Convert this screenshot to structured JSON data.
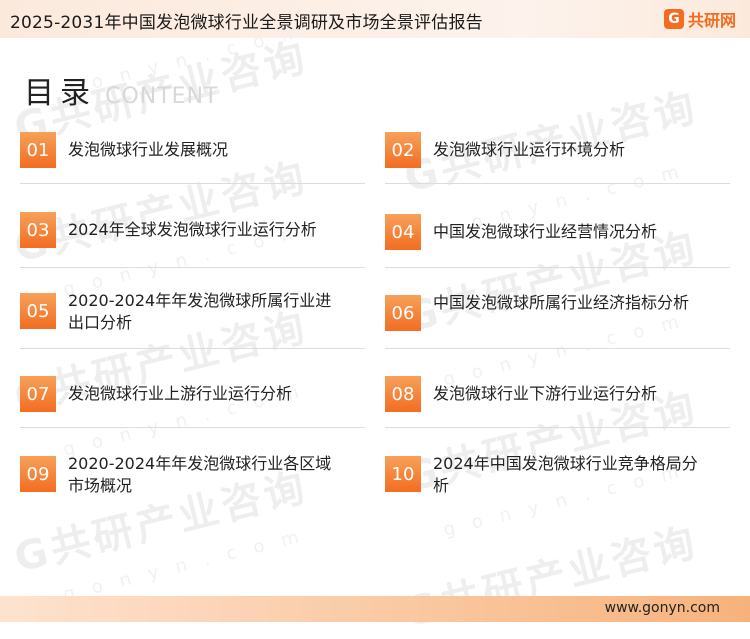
{
  "header": {
    "title": "2025-2031年中国发泡微球行业全景调研及市场全景评估报告"
  },
  "logo": {
    "mark": "G",
    "name": "共研网"
  },
  "watermark": {
    "text": "G共研产业咨询",
    "domain": "g o n y n . c o m"
  },
  "toc": {
    "title": "目录",
    "subtitle": "CONTENT",
    "items": [
      {
        "num": "01",
        "label": "发泡微球行业发展概况"
      },
      {
        "num": "02",
        "label": "发泡微球行业运行环境分析"
      },
      {
        "num": "03",
        "label": "2024年全球发泡微球行业运行分析"
      },
      {
        "num": "04",
        "label": "中国发泡微球行业经营情况分析"
      },
      {
        "num": "05",
        "label": "2020-2024年年发泡微球所属行业进出口分析"
      },
      {
        "num": "06",
        "label": "中国发泡微球所属行业经济指标分析"
      },
      {
        "num": "07",
        "label": "发泡微球行业上游行业运行分析"
      },
      {
        "num": "08",
        "label": "发泡微球行业下游行业运行分析"
      },
      {
        "num": "09",
        "label": "2020-2024年年发泡微球行业各区域市场概况"
      },
      {
        "num": "10",
        "label": "2024年中国发泡微球行业竞争格局分析"
      }
    ]
  },
  "footer": {
    "url": "www.gonyn.com"
  },
  "colors": {
    "accent": "#f26d21",
    "accent_light": "#f7a15a"
  }
}
